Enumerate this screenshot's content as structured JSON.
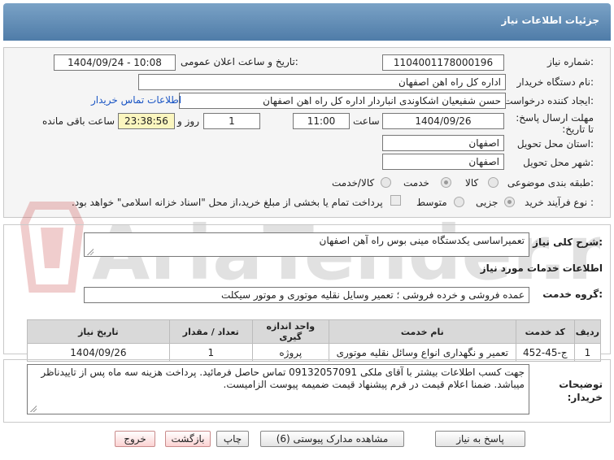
{
  "header": {
    "title": "جزئیات اطلاعات نیاز"
  },
  "fields": {
    "need_number_label": "شماره نیاز:",
    "need_number": "1104001178000196",
    "announce_label": "تاریخ و ساعت اعلان عمومی:",
    "announce_value": "1404/09/24 - 10:08",
    "buyer_label": "نام دستگاه خریدار:",
    "buyer_value": "اداره کل راه اهن اصفهان",
    "creator_label": "ایجاد کننده درخواست:",
    "creator_value": "حسن شفیعیان اشکاوندی انباردار اداره کل راه اهن اصفهان",
    "contact_link": "اطلاعات تماس خریدار",
    "deadline_label": "مهلت ارسال پاسخ: تا تاریخ:",
    "deadline_date": "1404/09/26",
    "time_label": "ساعت",
    "deadline_time": "11:00",
    "days_value": "1",
    "days_label": "روز و",
    "remaining_time": "23:38:56",
    "remaining_label": "ساعت باقی مانده",
    "province_label": "استان محل تحویل:",
    "province_value": "اصفهان",
    "city_label": "شهر محل تحویل:",
    "city_value": "اصفهان",
    "category_label": "طبقه بندی موضوعی:",
    "category_options": [
      "کالا",
      "خدمت",
      "کالا/خدمت"
    ],
    "category_selected": "خدمت",
    "process_label": "نوع فرآیند خرید :",
    "process_options": [
      "جزیی",
      "متوسط"
    ],
    "process_selected": "جزیی",
    "payment_note": "پرداخت تمام یا بخشی از مبلغ خرید،از محل \"اسناد خزانه اسلامی\" خواهد بود."
  },
  "description": {
    "label": "شرح کلی نیاز:",
    "value": "تعمیراساسی یکدستگاه مینی بوس راه آهن اصفهان"
  },
  "services": {
    "section_title": "اطلاعات خدمات مورد نیاز",
    "group_label": "گروه خدمت:",
    "group_value": "عمده فروشی و خرده فروشی ؛ تعمیر وسایل نقلیه موتوری و موتور سیکلت",
    "columns": [
      "ردیف",
      "کد خدمت",
      "نام خدمت",
      "واحد اندازه گیری",
      "تعداد / مقدار",
      "تاریخ نیاز"
    ],
    "rows": [
      {
        "row": "1",
        "code": "ج-45-452",
        "name": "تعمیر و نگهداری انواع وسائل نقلیه موتوری",
        "unit": "پروژه",
        "qty": "1",
        "date": "1404/09/26"
      }
    ]
  },
  "buyer_notes": {
    "label": "توضیحات خریدار:",
    "value": "جهت کسب اطلاعات بیشتر با آقای ملکی 09132057091 تماس حاصل فرمائید. پرداخت هزینه سه ماه پس از تاییدناظر میباشد. ضمنا اعلام قیمت در فرم پیشنهاد قیمت ضمیمه پیوست الزامیست."
  },
  "buttons": {
    "reply": "پاسخ به نیاز",
    "attachments": "مشاهده مدارک پیوستی (6)",
    "print": "چاپ",
    "back": "بازگشت",
    "exit": "خروج"
  },
  "watermark": {
    "text": "AriaTender.net"
  },
  "colors": {
    "header": "#5b86b0",
    "link": "#1a55c4",
    "panel": "#f5f5f5"
  }
}
